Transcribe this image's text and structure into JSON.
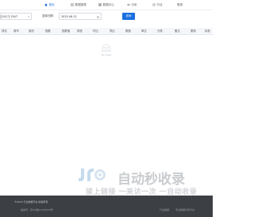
{
  "nav": {
    "items": [
      {
        "label": "首页",
        "icon": "home-icon"
      },
      {
        "label": "数据报表",
        "icon": "report-icon"
      },
      {
        "label": "数据中心",
        "icon": "data-icon"
      },
      {
        "label": "分析",
        "icon": "analysis-icon"
      },
      {
        "label": "行业",
        "icon": "industry-icon"
      },
      {
        "label": "登录",
        "icon": ""
      }
    ]
  },
  "filters": {
    "select_value": "[2017] 2547",
    "date_label": "选择日期：",
    "date_value": "2025-06-12",
    "query_label": "查询"
  },
  "table": {
    "headers": [
      "排名",
      "城市",
      "省份",
      "指数",
      "指数值",
      "排放",
      "环比",
      "同比",
      "数值",
      "单位",
      "分类",
      "备注",
      "更新",
      "标准"
    ]
  },
  "empty": {
    "text": "No Data"
  },
  "watermark": {
    "title": "自动秒收录",
    "slogan": "骏上链接 一来访一次 一自动收录"
  },
  "footer": {
    "copyright": "©2025 行业数据平台 版权所有",
    "icp": "备案号：京ICP备12345678号",
    "links": "行业数据",
    "right": "专业数据分析平台"
  },
  "colors": {
    "accent": "#1a6fe0",
    "footer_bg": "#3c3f44"
  }
}
